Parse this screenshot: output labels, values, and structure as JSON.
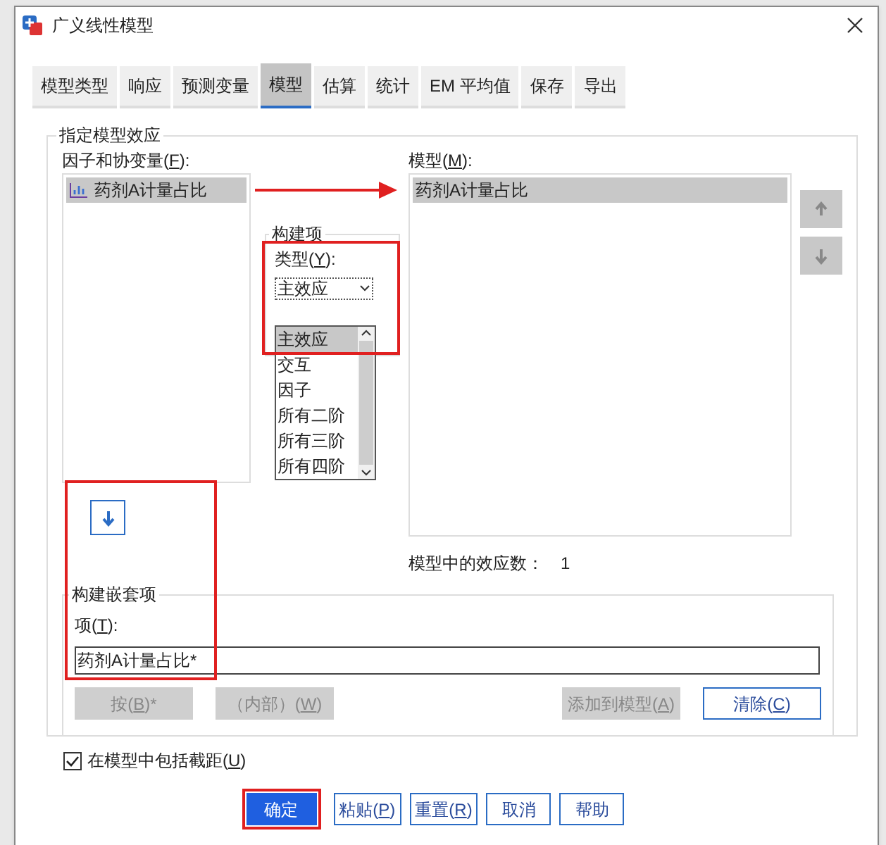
{
  "window": {
    "title": "广义线性模型"
  },
  "tabs": [
    {
      "label": "模型类型",
      "selected": false
    },
    {
      "label": "响应",
      "selected": false
    },
    {
      "label": "预测变量",
      "selected": false
    },
    {
      "label": "模型",
      "selected": true
    },
    {
      "label": "估算",
      "selected": false
    },
    {
      "label": "统计",
      "selected": false
    },
    {
      "label": "EM 平均值",
      "selected": false
    },
    {
      "label": "保存",
      "selected": false
    },
    {
      "label": "导出",
      "selected": false
    }
  ],
  "effects_group": {
    "title": "指定模型效应"
  },
  "factors": {
    "label": {
      "pre": "因子和协变量(",
      "key": "F",
      "post": "):"
    },
    "items": [
      {
        "text": "药剂A计量占比",
        "selected": true
      }
    ]
  },
  "build_term": {
    "title": "构建项",
    "type_label": {
      "pre": "类型(",
      "key": "Y",
      "post": "):"
    },
    "type_value": "主效应",
    "options": [
      {
        "text": "主效应",
        "selected": true
      },
      {
        "text": "交互",
        "selected": false
      },
      {
        "text": "因子",
        "selected": false
      },
      {
        "text": "所有二阶",
        "selected": false
      },
      {
        "text": "所有三阶",
        "selected": false
      },
      {
        "text": "所有四阶",
        "selected": false
      }
    ]
  },
  "model": {
    "label": {
      "pre": "模型(",
      "key": "M",
      "post": "):"
    },
    "items": [
      {
        "text": "药剂A计量占比",
        "selected": true
      }
    ],
    "move_up_disabled": true,
    "move_down_disabled": true
  },
  "effects_count": {
    "label": "模型中的效应数：",
    "value": "1"
  },
  "nested": {
    "title": "构建嵌套项",
    "term_label": {
      "pre": "项(",
      "key": "T",
      "post": "):"
    },
    "term_value": "药剂A计量占比*",
    "buttons": [
      {
        "label": {
          "pre": "按(",
          "key": "B",
          "post": ")*"
        },
        "disabled": true
      },
      {
        "label": {
          "pre": "（内部）(",
          "key": "W",
          "post": ")"
        },
        "disabled": true
      },
      {
        "label": {
          "pre": "添加到模型(",
          "key": "A",
          "post": ")"
        },
        "disabled": true
      },
      {
        "label": {
          "pre": "清除(",
          "key": "C",
          "post": ")"
        },
        "disabled": false
      }
    ]
  },
  "intercept": {
    "label": {
      "pre": "在模型中包括截距(",
      "key": "U",
      "post": ")"
    },
    "checked": true
  },
  "footer_buttons": [
    {
      "label": {
        "pre": "确定"
      },
      "kind": "primary"
    },
    {
      "label": {
        "pre": "粘贴(",
        "key": "P",
        "post": ")"
      },
      "kind": "normal"
    },
    {
      "label": {
        "pre": "重置(",
        "key": "R",
        "post": ")"
      },
      "kind": "normal"
    },
    {
      "label": {
        "pre": "取消"
      },
      "kind": "normal"
    },
    {
      "label": {
        "pre": "帮助"
      },
      "kind": "normal"
    }
  ]
}
